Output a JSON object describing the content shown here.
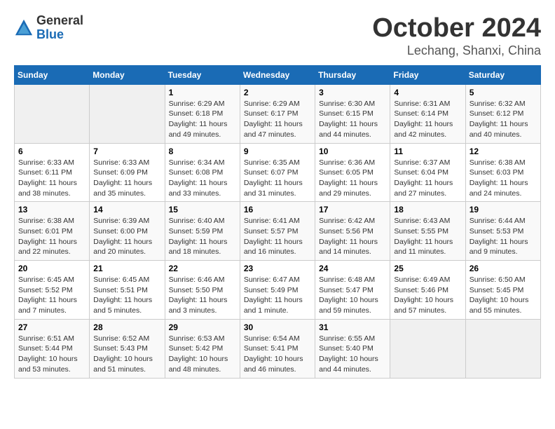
{
  "logo": {
    "general": "General",
    "blue": "Blue"
  },
  "title": "October 2024",
  "location": "Lechang, Shanxi, China",
  "weekdays": [
    "Sunday",
    "Monday",
    "Tuesday",
    "Wednesday",
    "Thursday",
    "Friday",
    "Saturday"
  ],
  "weeks": [
    [
      {
        "day": "",
        "info": ""
      },
      {
        "day": "",
        "info": ""
      },
      {
        "day": "1",
        "info": "Sunrise: 6:29 AM\nSunset: 6:18 PM\nDaylight: 11 hours and 49 minutes."
      },
      {
        "day": "2",
        "info": "Sunrise: 6:29 AM\nSunset: 6:17 PM\nDaylight: 11 hours and 47 minutes."
      },
      {
        "day": "3",
        "info": "Sunrise: 6:30 AM\nSunset: 6:15 PM\nDaylight: 11 hours and 44 minutes."
      },
      {
        "day": "4",
        "info": "Sunrise: 6:31 AM\nSunset: 6:14 PM\nDaylight: 11 hours and 42 minutes."
      },
      {
        "day": "5",
        "info": "Sunrise: 6:32 AM\nSunset: 6:12 PM\nDaylight: 11 hours and 40 minutes."
      }
    ],
    [
      {
        "day": "6",
        "info": "Sunrise: 6:33 AM\nSunset: 6:11 PM\nDaylight: 11 hours and 38 minutes."
      },
      {
        "day": "7",
        "info": "Sunrise: 6:33 AM\nSunset: 6:09 PM\nDaylight: 11 hours and 35 minutes."
      },
      {
        "day": "8",
        "info": "Sunrise: 6:34 AM\nSunset: 6:08 PM\nDaylight: 11 hours and 33 minutes."
      },
      {
        "day": "9",
        "info": "Sunrise: 6:35 AM\nSunset: 6:07 PM\nDaylight: 11 hours and 31 minutes."
      },
      {
        "day": "10",
        "info": "Sunrise: 6:36 AM\nSunset: 6:05 PM\nDaylight: 11 hours and 29 minutes."
      },
      {
        "day": "11",
        "info": "Sunrise: 6:37 AM\nSunset: 6:04 PM\nDaylight: 11 hours and 27 minutes."
      },
      {
        "day": "12",
        "info": "Sunrise: 6:38 AM\nSunset: 6:03 PM\nDaylight: 11 hours and 24 minutes."
      }
    ],
    [
      {
        "day": "13",
        "info": "Sunrise: 6:38 AM\nSunset: 6:01 PM\nDaylight: 11 hours and 22 minutes."
      },
      {
        "day": "14",
        "info": "Sunrise: 6:39 AM\nSunset: 6:00 PM\nDaylight: 11 hours and 20 minutes."
      },
      {
        "day": "15",
        "info": "Sunrise: 6:40 AM\nSunset: 5:59 PM\nDaylight: 11 hours and 18 minutes."
      },
      {
        "day": "16",
        "info": "Sunrise: 6:41 AM\nSunset: 5:57 PM\nDaylight: 11 hours and 16 minutes."
      },
      {
        "day": "17",
        "info": "Sunrise: 6:42 AM\nSunset: 5:56 PM\nDaylight: 11 hours and 14 minutes."
      },
      {
        "day": "18",
        "info": "Sunrise: 6:43 AM\nSunset: 5:55 PM\nDaylight: 11 hours and 11 minutes."
      },
      {
        "day": "19",
        "info": "Sunrise: 6:44 AM\nSunset: 5:53 PM\nDaylight: 11 hours and 9 minutes."
      }
    ],
    [
      {
        "day": "20",
        "info": "Sunrise: 6:45 AM\nSunset: 5:52 PM\nDaylight: 11 hours and 7 minutes."
      },
      {
        "day": "21",
        "info": "Sunrise: 6:45 AM\nSunset: 5:51 PM\nDaylight: 11 hours and 5 minutes."
      },
      {
        "day": "22",
        "info": "Sunrise: 6:46 AM\nSunset: 5:50 PM\nDaylight: 11 hours and 3 minutes."
      },
      {
        "day": "23",
        "info": "Sunrise: 6:47 AM\nSunset: 5:49 PM\nDaylight: 11 hours and 1 minute."
      },
      {
        "day": "24",
        "info": "Sunrise: 6:48 AM\nSunset: 5:47 PM\nDaylight: 10 hours and 59 minutes."
      },
      {
        "day": "25",
        "info": "Sunrise: 6:49 AM\nSunset: 5:46 PM\nDaylight: 10 hours and 57 minutes."
      },
      {
        "day": "26",
        "info": "Sunrise: 6:50 AM\nSunset: 5:45 PM\nDaylight: 10 hours and 55 minutes."
      }
    ],
    [
      {
        "day": "27",
        "info": "Sunrise: 6:51 AM\nSunset: 5:44 PM\nDaylight: 10 hours and 53 minutes."
      },
      {
        "day": "28",
        "info": "Sunrise: 6:52 AM\nSunset: 5:43 PM\nDaylight: 10 hours and 51 minutes."
      },
      {
        "day": "29",
        "info": "Sunrise: 6:53 AM\nSunset: 5:42 PM\nDaylight: 10 hours and 48 minutes."
      },
      {
        "day": "30",
        "info": "Sunrise: 6:54 AM\nSunset: 5:41 PM\nDaylight: 10 hours and 46 minutes."
      },
      {
        "day": "31",
        "info": "Sunrise: 6:55 AM\nSunset: 5:40 PM\nDaylight: 10 hours and 44 minutes."
      },
      {
        "day": "",
        "info": ""
      },
      {
        "day": "",
        "info": ""
      }
    ]
  ]
}
